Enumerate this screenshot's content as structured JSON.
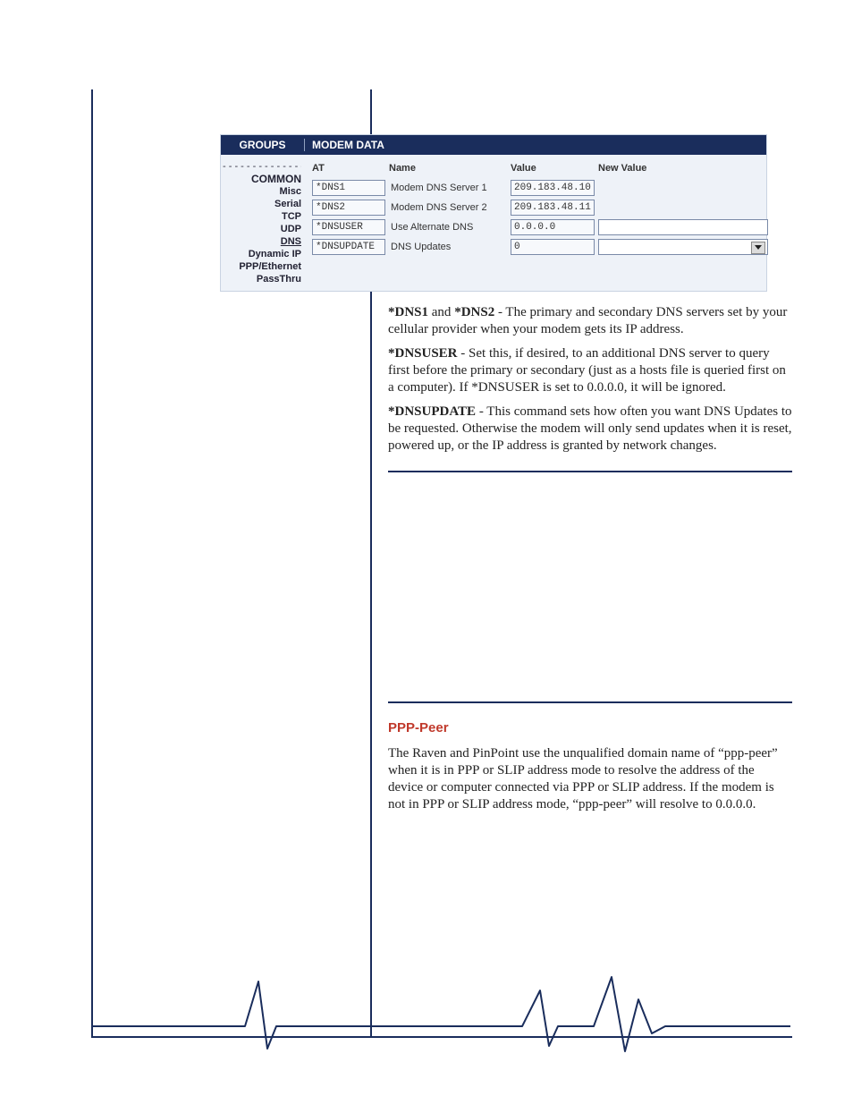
{
  "table": {
    "header_groups": "GROUPS",
    "header_modem": "MODEM DATA",
    "sidebar": {
      "dash": "- - - - - - - - - - - - - -",
      "heading": "COMMON",
      "items": [
        "Misc",
        "Serial",
        "TCP",
        "UDP",
        "DNS",
        "Dynamic IP",
        "PPP/Ethernet",
        "PassThru"
      ],
      "active": "DNS"
    },
    "columns": [
      "AT",
      "Name",
      "Value",
      "New Value"
    ],
    "rows": [
      {
        "at": "*DNS1",
        "name": "Modem DNS Server 1",
        "value": "209.183.48.10",
        "new_value": "",
        "input_type": "none"
      },
      {
        "at": "*DNS2",
        "name": "Modem DNS Server 2",
        "value": "209.183.48.11",
        "new_value": "",
        "input_type": "none"
      },
      {
        "at": "*DNSUSER",
        "name": "Use Alternate DNS",
        "value": "0.0.0.0",
        "new_value": "",
        "input_type": "text"
      },
      {
        "at": "*DNSUPDATE",
        "name": "DNS Updates",
        "value": "0",
        "new_value": "",
        "input_type": "select"
      }
    ]
  },
  "body": {
    "p1_b1": "*DNS1",
    "p1_mid": " and ",
    "p1_b2": "*DNS2",
    "p1_rest": " - The primary and secondary DNS servers set by your cellular provider when your modem gets its IP address.",
    "p2_b": "*DNSUSER",
    "p2_rest": " - Set this, if desired, to an additional DNS server to query first before the primary or secondary (just as a hosts file is queried first on a computer).  If *DNSUSER is set to 0.0.0.0, it will be ignored.",
    "p3_b": "*DNSUPDATE",
    "p3_rest": " - This command sets how often you want DNS Updates to be requested. Otherwise the  modem will only send updates when it is reset, powered up, or the IP address is granted by network changes.",
    "section_title": "PPP-Peer",
    "p4": "The Raven and PinPoint use the unqualified domain name of “ppp-peer” when it is in PPP or SLIP address mode to resolve the address of the device or computer connected via PPP or SLIP address.  If the modem is not in PPP or SLIP address mode, “ppp-peer” will resolve to 0.0.0.0."
  }
}
